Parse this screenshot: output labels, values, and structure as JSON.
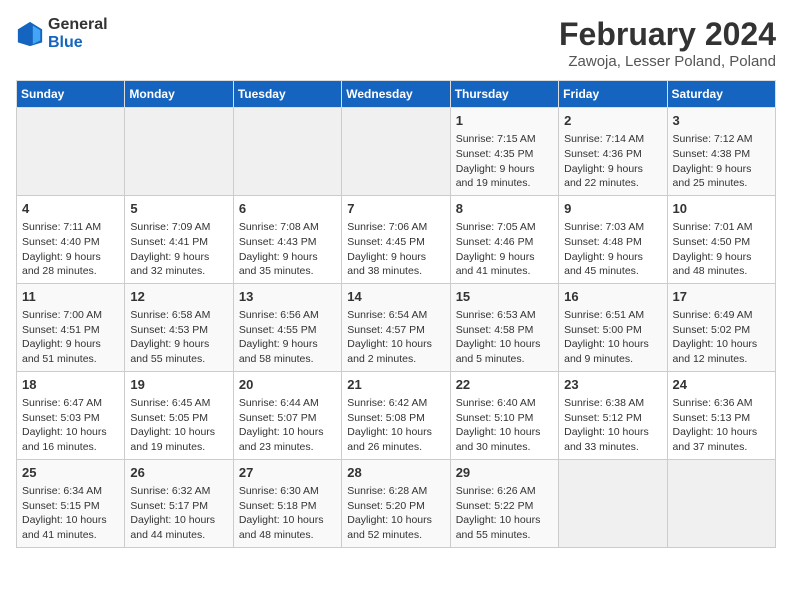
{
  "logo": {
    "line1": "General",
    "line2": "Blue"
  },
  "title": "February 2024",
  "subtitle": "Zawoja, Lesser Poland, Poland",
  "weekdays": [
    "Sunday",
    "Monday",
    "Tuesday",
    "Wednesday",
    "Thursday",
    "Friday",
    "Saturday"
  ],
  "weeks": [
    [
      {
        "day": "",
        "info": ""
      },
      {
        "day": "",
        "info": ""
      },
      {
        "day": "",
        "info": ""
      },
      {
        "day": "",
        "info": ""
      },
      {
        "day": "1",
        "info": "Sunrise: 7:15 AM\nSunset: 4:35 PM\nDaylight: 9 hours\nand 19 minutes."
      },
      {
        "day": "2",
        "info": "Sunrise: 7:14 AM\nSunset: 4:36 PM\nDaylight: 9 hours\nand 22 minutes."
      },
      {
        "day": "3",
        "info": "Sunrise: 7:12 AM\nSunset: 4:38 PM\nDaylight: 9 hours\nand 25 minutes."
      }
    ],
    [
      {
        "day": "4",
        "info": "Sunrise: 7:11 AM\nSunset: 4:40 PM\nDaylight: 9 hours\nand 28 minutes."
      },
      {
        "day": "5",
        "info": "Sunrise: 7:09 AM\nSunset: 4:41 PM\nDaylight: 9 hours\nand 32 minutes."
      },
      {
        "day": "6",
        "info": "Sunrise: 7:08 AM\nSunset: 4:43 PM\nDaylight: 9 hours\nand 35 minutes."
      },
      {
        "day": "7",
        "info": "Sunrise: 7:06 AM\nSunset: 4:45 PM\nDaylight: 9 hours\nand 38 minutes."
      },
      {
        "day": "8",
        "info": "Sunrise: 7:05 AM\nSunset: 4:46 PM\nDaylight: 9 hours\nand 41 minutes."
      },
      {
        "day": "9",
        "info": "Sunrise: 7:03 AM\nSunset: 4:48 PM\nDaylight: 9 hours\nand 45 minutes."
      },
      {
        "day": "10",
        "info": "Sunrise: 7:01 AM\nSunset: 4:50 PM\nDaylight: 9 hours\nand 48 minutes."
      }
    ],
    [
      {
        "day": "11",
        "info": "Sunrise: 7:00 AM\nSunset: 4:51 PM\nDaylight: 9 hours\nand 51 minutes."
      },
      {
        "day": "12",
        "info": "Sunrise: 6:58 AM\nSunset: 4:53 PM\nDaylight: 9 hours\nand 55 minutes."
      },
      {
        "day": "13",
        "info": "Sunrise: 6:56 AM\nSunset: 4:55 PM\nDaylight: 9 hours\nand 58 minutes."
      },
      {
        "day": "14",
        "info": "Sunrise: 6:54 AM\nSunset: 4:57 PM\nDaylight: 10 hours\nand 2 minutes."
      },
      {
        "day": "15",
        "info": "Sunrise: 6:53 AM\nSunset: 4:58 PM\nDaylight: 10 hours\nand 5 minutes."
      },
      {
        "day": "16",
        "info": "Sunrise: 6:51 AM\nSunset: 5:00 PM\nDaylight: 10 hours\nand 9 minutes."
      },
      {
        "day": "17",
        "info": "Sunrise: 6:49 AM\nSunset: 5:02 PM\nDaylight: 10 hours\nand 12 minutes."
      }
    ],
    [
      {
        "day": "18",
        "info": "Sunrise: 6:47 AM\nSunset: 5:03 PM\nDaylight: 10 hours\nand 16 minutes."
      },
      {
        "day": "19",
        "info": "Sunrise: 6:45 AM\nSunset: 5:05 PM\nDaylight: 10 hours\nand 19 minutes."
      },
      {
        "day": "20",
        "info": "Sunrise: 6:44 AM\nSunset: 5:07 PM\nDaylight: 10 hours\nand 23 minutes."
      },
      {
        "day": "21",
        "info": "Sunrise: 6:42 AM\nSunset: 5:08 PM\nDaylight: 10 hours\nand 26 minutes."
      },
      {
        "day": "22",
        "info": "Sunrise: 6:40 AM\nSunset: 5:10 PM\nDaylight: 10 hours\nand 30 minutes."
      },
      {
        "day": "23",
        "info": "Sunrise: 6:38 AM\nSunset: 5:12 PM\nDaylight: 10 hours\nand 33 minutes."
      },
      {
        "day": "24",
        "info": "Sunrise: 6:36 AM\nSunset: 5:13 PM\nDaylight: 10 hours\nand 37 minutes."
      }
    ],
    [
      {
        "day": "25",
        "info": "Sunrise: 6:34 AM\nSunset: 5:15 PM\nDaylight: 10 hours\nand 41 minutes."
      },
      {
        "day": "26",
        "info": "Sunrise: 6:32 AM\nSunset: 5:17 PM\nDaylight: 10 hours\nand 44 minutes."
      },
      {
        "day": "27",
        "info": "Sunrise: 6:30 AM\nSunset: 5:18 PM\nDaylight: 10 hours\nand 48 minutes."
      },
      {
        "day": "28",
        "info": "Sunrise: 6:28 AM\nSunset: 5:20 PM\nDaylight: 10 hours\nand 52 minutes."
      },
      {
        "day": "29",
        "info": "Sunrise: 6:26 AM\nSunset: 5:22 PM\nDaylight: 10 hours\nand 55 minutes."
      },
      {
        "day": "",
        "info": ""
      },
      {
        "day": "",
        "info": ""
      }
    ]
  ]
}
